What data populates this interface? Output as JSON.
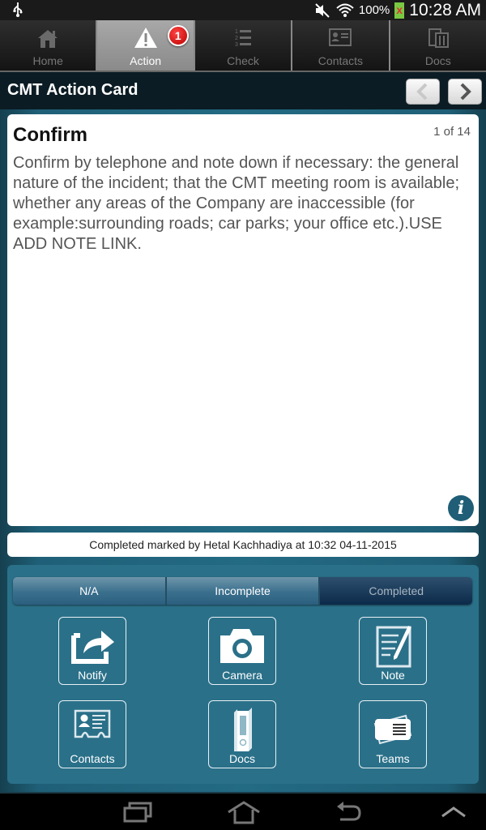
{
  "status_bar": {
    "battery_percent": "100%",
    "time": "10:28 AM",
    "icons": [
      "usb-icon",
      "mute-icon",
      "wifi-icon",
      "battery-icon"
    ]
  },
  "tabs": [
    {
      "label": "Home",
      "icon": "home-icon",
      "active": false
    },
    {
      "label": "Action",
      "icon": "warning-icon",
      "active": true,
      "badge": "1"
    },
    {
      "label": "Check",
      "icon": "numbered-list-icon",
      "active": false
    },
    {
      "label": "Contacts",
      "icon": "contact-card-icon",
      "active": false
    },
    {
      "label": "Docs",
      "icon": "documents-icon",
      "active": false
    }
  ],
  "header": {
    "title": "CMT Action Card",
    "prev_icon": "chevron-left-icon",
    "next_icon": "chevron-right-icon"
  },
  "card": {
    "title": "Confirm",
    "pager": "1 of 14",
    "body": "Confirm by telephone and note down if necessary: the general nature of the incident; that the CMT meeting room is available; whether any areas of the Company are inaccessible (for example:surrounding roads; car parks; your office etc.).USE ADD NOTE LINK.",
    "info_icon": "i"
  },
  "completion_status": "Completed marked by Hetal Kachhadiya at 10:32 04-11-2015",
  "status_segments": {
    "options": [
      "N/A",
      "Incomplete",
      "Completed"
    ],
    "selected": "Completed"
  },
  "actions": [
    {
      "label": "Notify",
      "icon": "share-icon"
    },
    {
      "label": "Camera",
      "icon": "camera-icon"
    },
    {
      "label": "Note",
      "icon": "note-icon"
    },
    {
      "label": "Contacts",
      "icon": "contact-card-icon"
    },
    {
      "label": "Docs",
      "icon": "binder-icon"
    },
    {
      "label": "Teams",
      "icon": "team-cards-icon"
    }
  ],
  "colors": {
    "panel": "#2a7089",
    "header": "#0b1c24",
    "badge": "#cc1111",
    "info": "#1f5e76"
  }
}
